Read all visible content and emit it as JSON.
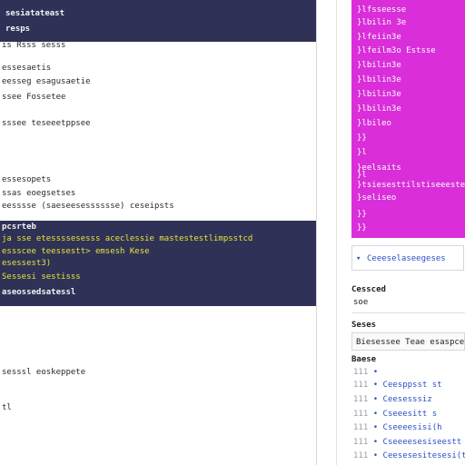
{
  "editor": {
    "top_lines": [
      "sesiatateast",
      "resps"
    ],
    "body_lines": [
      "is Rsss sesss",
      "essesaetis",
      "eesseg esagusaetie",
      "ssee Fossetee",
      "sssee teseeetppsee",
      "essesopets",
      "ssas eoegsetses",
      "eesssse (saeseesesssssse) ceseipsts"
    ],
    "mid_lines": [
      {
        "text": "pcsrteb",
        "color": "white"
      },
      {
        "text": "ja sse etessssesesss aceclessie mastestestlimpsstcd",
        "color": "yellow"
      },
      {
        "text": "essscee teessestt> emsesh Kese",
        "color": "yellow"
      },
      {
        "text": "esessest3)",
        "color": "yellow"
      },
      {
        "text": "Sessesi sestisss",
        "color": "yellow"
      },
      {
        "text": "aseossedsatessl",
        "color": "white"
      }
    ],
    "bottom_lines": [
      "sesssl eoskeppete",
      "tl"
    ]
  },
  "code_panel": {
    "lines": [
      "}lfsseesse",
      "}lbilin 3e",
      "}lfeiin3e",
      "}lfeilm3o  Estsse",
      "}lbilin3e",
      "}lbilin3e",
      "}lbilin3e",
      "}lbilin3e",
      "}lbileo",
      "}}",
      "}l",
      "}eelsaits",
      "}l",
      "}tsiesesttilstiseeestesry",
      "}seliseo",
      "}}",
      "}}"
    ]
  },
  "right_panel": {
    "outline_label": "Ceeeselaseegeses",
    "section1_title": "Cessced",
    "section1_value": "soe",
    "section2_title": "Seses",
    "info_text": "Biesessee Teae esaspcete",
    "section3_title": "Baese",
    "list_items": [
      {
        "num": "111",
        "text": ""
      },
      {
        "num": "111",
        "text": "Ceesppsst   st"
      },
      {
        "num": "111",
        "text": "Ceesesssiz"
      },
      {
        "num": "111",
        "text": "Cseeesitt   s"
      },
      {
        "num": "111",
        "text": "Cseeeesisi(h"
      },
      {
        "num": "111",
        "text": "Cseeeesesiseestt"
      },
      {
        "num": "111",
        "text": "Ceesesesitesesi(th"
      }
    ]
  },
  "colors": {
    "dark_bg": "#2f3256",
    "magenta_bg": "#d92ed9",
    "link_blue": "#2d4fc7",
    "highlight_yellow": "#e8e23a"
  }
}
